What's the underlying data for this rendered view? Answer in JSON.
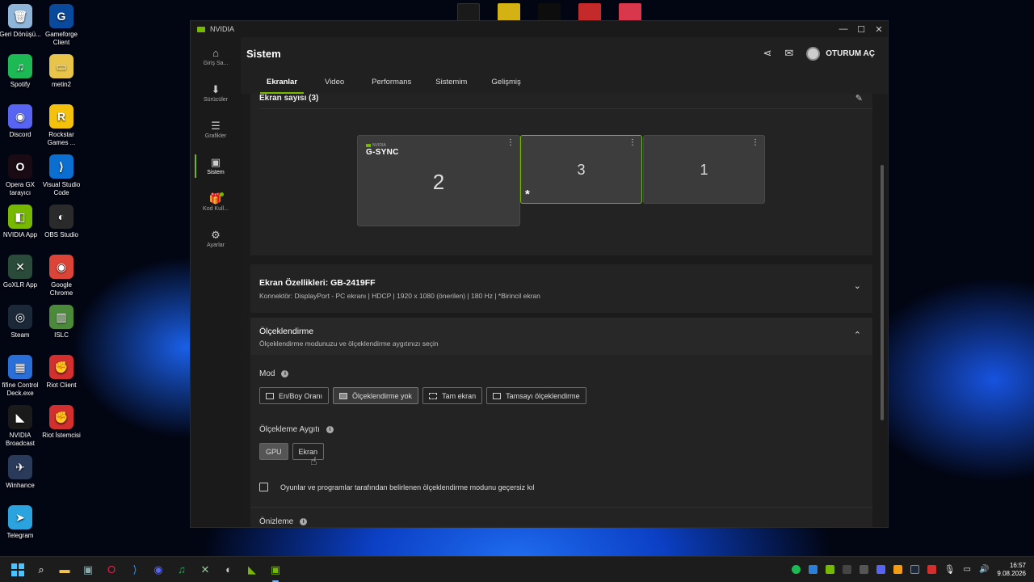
{
  "desktop": {
    "icons_left": [
      {
        "label": "Geri Dönüşü...",
        "color": "#8fb6d9",
        "glyph": "🗑"
      },
      {
        "label": "Spotify",
        "color": "#1db954",
        "glyph": "♫"
      },
      {
        "label": "Discord",
        "color": "#5865f2",
        "glyph": "◉"
      },
      {
        "label": "Opera GX tarayıcı",
        "color": "#1a0a14",
        "glyph": "O"
      },
      {
        "label": "NVIDIA App",
        "color": "#76b900",
        "glyph": "◧"
      },
      {
        "label": "GoXLR App",
        "color": "#2a4a3a",
        "glyph": "✕"
      },
      {
        "label": "Steam",
        "color": "#1b2838",
        "glyph": "◎"
      },
      {
        "label": "fifine Control Deck.exe",
        "color": "#2a6fd8",
        "glyph": "▦"
      },
      {
        "label": "NVIDIA Broadcast",
        "color": "#1a1a1a",
        "glyph": "◣"
      },
      {
        "label": "Winhance",
        "color": "#2a3a5a",
        "glyph": "✈"
      },
      {
        "label": "Telegram",
        "color": "#2aa3df",
        "glyph": "➤"
      }
    ],
    "icons_right": [
      {
        "label": "Gameforge Client",
        "color": "#0a4a9c",
        "glyph": "G"
      },
      {
        "label": "metin2",
        "color": "#e8c44a",
        "glyph": "▭"
      },
      {
        "label": "Rockstar Games ...",
        "color": "#f4c20d",
        "glyph": "R"
      },
      {
        "label": "Visual Studio Code",
        "color": "#0a6fd0",
        "glyph": "⟩"
      },
      {
        "label": "OBS Studio",
        "color": "#2a2a2a",
        "glyph": "◐"
      },
      {
        "label": "Google Chrome",
        "color": "#db4437",
        "glyph": "◉"
      },
      {
        "label": "ISLC",
        "color": "#4a8a3a",
        "glyph": "▥"
      },
      {
        "label": "Riot Client",
        "color": "#d32f2f",
        "glyph": "✊"
      },
      {
        "label": "Riot İstemcisi",
        "color": "#d32f2f",
        "glyph": "✊"
      }
    ]
  },
  "window": {
    "app_title": "NVIDIA",
    "controls": {
      "minimize": "—",
      "maximize": "☐",
      "close": "✕"
    }
  },
  "sidebar": {
    "items": [
      {
        "label": "Giriş Sa...",
        "icon": "⌂"
      },
      {
        "label": "Sürücüler",
        "icon": "⬇"
      },
      {
        "label": "Grafikler",
        "icon": "☰"
      },
      {
        "label": "Sistem",
        "icon": "▣"
      },
      {
        "label": "Kod Kull...",
        "icon": "🎁"
      },
      {
        "label": "Ayarlar",
        "icon": "⚙"
      }
    ]
  },
  "header": {
    "title": "Sistem",
    "share_icon": "⋖",
    "feedback_icon": "✉",
    "login_label": "OTURUM AÇ"
  },
  "tabs": [
    "Ekranlar",
    "Video",
    "Performans",
    "Sistemim",
    "Gelişmiş"
  ],
  "screens": {
    "title": "Ekran sayısı (3)",
    "edit_icon": "✎",
    "monitors": [
      {
        "number": "2",
        "gsync_brand": "NVIDIA",
        "gsync_label": "G-SYNC"
      },
      {
        "number": "3",
        "star": "*"
      },
      {
        "number": "1"
      }
    ],
    "menu_glyph": "⋮"
  },
  "properties": {
    "title": "Ekran Özellikleri: GB-2419FF",
    "subtitle": "Konnektör: DisplayPort - PC ekranı | HDCP | 1920 x 1080 (önerilen) | 180 Hz | *Birincil ekran",
    "chevron": "⌄"
  },
  "scaling": {
    "title": "Ölçeklendirme",
    "subtitle": "Ölçeklendirme modunuzu ve ölçeklendirme aygıtınızı seçin",
    "chevron": "⌃",
    "mode_label": "Mod",
    "modes": [
      "En/Boy Oranı",
      "Ölçeklendirme yok",
      "Tam ekran",
      "Tamsayı ölçeklendirme"
    ],
    "device_label": "Ölçekleme Aygıtı",
    "devices": [
      "GPU",
      "Ekran"
    ],
    "override_label": "Oyunlar ve programlar tarafından belirlenen ölçeklendirme modunu geçersiz kıl",
    "preview_label": "Önizleme",
    "info_glyph": "i"
  },
  "taskbar": {
    "time": "16:57",
    "date": "9.08.2026"
  }
}
